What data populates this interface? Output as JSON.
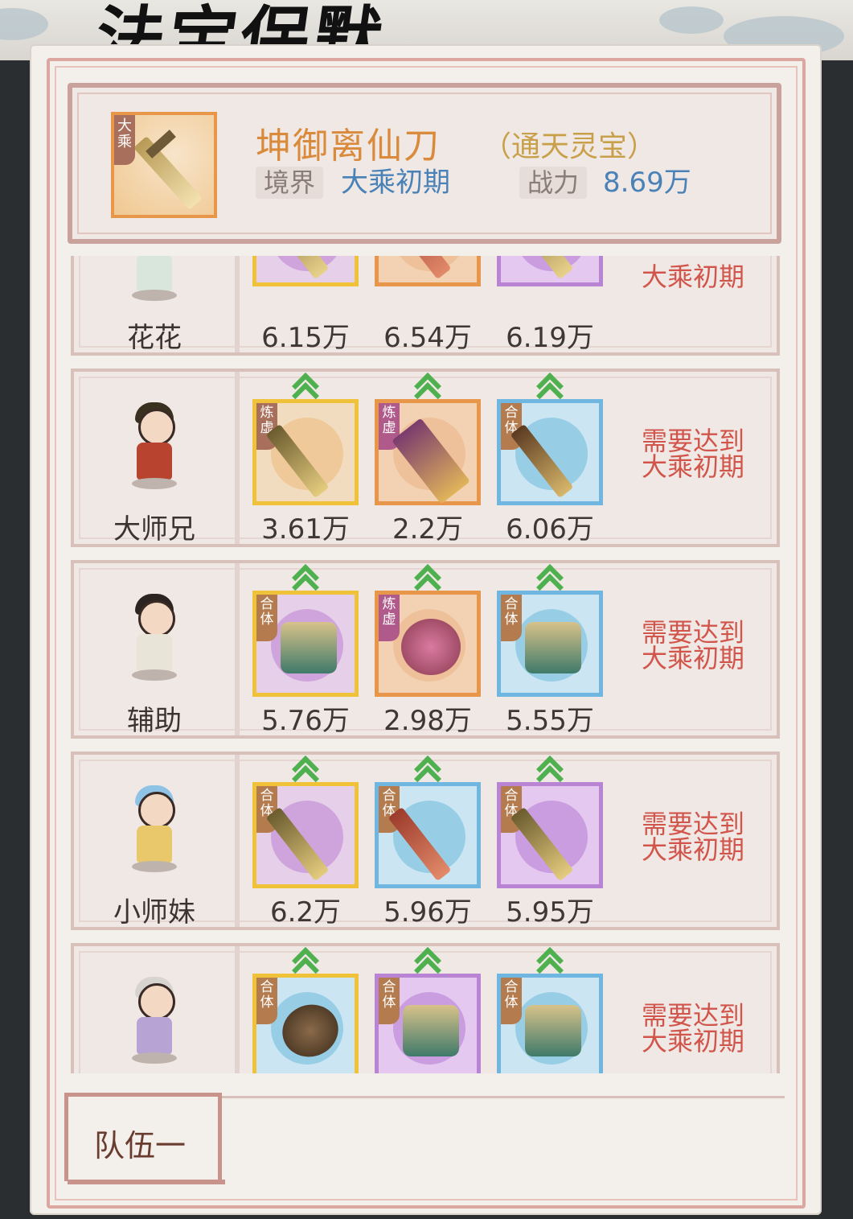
{
  "page_title": "法宝保默",
  "header": {
    "item_name": "坤御离仙刀",
    "grade": "（通天灵宝）",
    "icon_tag": "大乘",
    "realm_label": "境界",
    "realm_value": "大乘初期",
    "power_label": "战力",
    "power_value": "8.69万"
  },
  "rows": [
    {
      "name": "花花",
      "slots": [
        {
          "power": "6.15万",
          "tag": "",
          "frame": "gold",
          "bg": "purple"
        },
        {
          "power": "6.54万",
          "tag": "",
          "frame": "orange",
          "bg": "orange"
        },
        {
          "power": "6.19万",
          "tag": "",
          "frame": "purple",
          "bg": "purple"
        }
      ],
      "requirement": "大乘初期"
    },
    {
      "name": "大师兄",
      "slots": [
        {
          "power": "3.61万",
          "tag": "炼虚",
          "frame": "gold",
          "bg": "orange"
        },
        {
          "power": "2.2万",
          "tag": "炼虚",
          "frame": "orange",
          "bg": "orange"
        },
        {
          "power": "6.06万",
          "tag": "合体",
          "frame": "blue",
          "bg": "blue"
        }
      ],
      "requirement": "需要达到大乘初期"
    },
    {
      "name": "辅助",
      "slots": [
        {
          "power": "5.76万",
          "tag": "合体",
          "frame": "gold",
          "bg": "purple"
        },
        {
          "power": "2.98万",
          "tag": "炼虚",
          "frame": "orange",
          "bg": "orange"
        },
        {
          "power": "5.55万",
          "tag": "合体",
          "frame": "blue",
          "bg": "blue"
        }
      ],
      "requirement": "需要达到大乘初期"
    },
    {
      "name": "小师妹",
      "slots": [
        {
          "power": "6.2万",
          "tag": "合体",
          "frame": "gold",
          "bg": "purple"
        },
        {
          "power": "5.96万",
          "tag": "合体",
          "frame": "blue",
          "bg": "blue"
        },
        {
          "power": "5.95万",
          "tag": "合体",
          "frame": "purple",
          "bg": "purple"
        }
      ],
      "requirement": "需要达到大乘初期"
    },
    {
      "name": "",
      "slots": [
        {
          "power": "",
          "tag": "合体",
          "frame": "gold",
          "bg": "blue"
        },
        {
          "power": "",
          "tag": "合体",
          "frame": "purple",
          "bg": "purple"
        },
        {
          "power": "",
          "tag": "合体",
          "frame": "blue",
          "bg": "blue"
        }
      ],
      "requirement": "需要达到大乘初期"
    }
  ],
  "team_tab": "队伍一"
}
